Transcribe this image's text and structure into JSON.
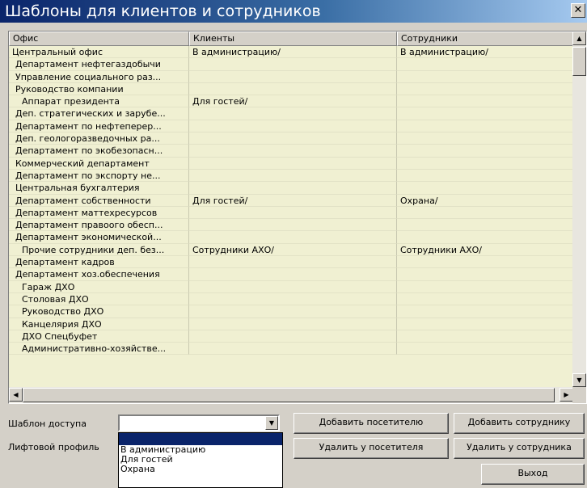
{
  "window": {
    "title": "Шаблоны для клиентов и сотрудников",
    "close_label": "✕"
  },
  "table": {
    "columns": [
      "Офис",
      "Клиенты",
      "Сотрудники"
    ],
    "rows": [
      [
        "Центральный офис",
        "В администрацию/",
        "В администрацию/"
      ],
      [
        "Департамент нефтегаздобычи",
        "",
        ""
      ],
      [
        "Управление социального раз...",
        "",
        ""
      ],
      [
        "Руководство компании",
        "",
        ""
      ],
      [
        "Аппарат президента",
        "Для гостей/",
        ""
      ],
      [
        "Деп. стратегических и зарубе...",
        "",
        ""
      ],
      [
        "Департамент по нефтеперер...",
        "",
        ""
      ],
      [
        "Деп. геологоразведочных ра...",
        "",
        ""
      ],
      [
        "Департамент по экобезопасн...",
        "",
        ""
      ],
      [
        "Коммерческий департамент",
        "",
        ""
      ],
      [
        "Департамент по экспорту не...",
        "",
        ""
      ],
      [
        "Центральная бухгалтерия",
        "",
        ""
      ],
      [
        "Департамент собственности",
        "Для гостей/",
        "Охрана/"
      ],
      [
        "Департамент маттехресурсов",
        "",
        ""
      ],
      [
        "Департамент правоого обесп...",
        "",
        ""
      ],
      [
        "Департамент экономической...",
        "",
        ""
      ],
      [
        "Прочие сотрудники деп. без...",
        "Сотрудники АХО/",
        "Сотрудники АХО/"
      ],
      [
        "Департамент кадров",
        "",
        ""
      ],
      [
        "Департамент хоз.обеспечения",
        "",
        ""
      ],
      [
        "Гараж ДХО",
        "",
        ""
      ],
      [
        "Столовая ДХО",
        "",
        ""
      ],
      [
        "Руководство ДХО",
        "",
        ""
      ],
      [
        "Канцелярия ДХО",
        "",
        ""
      ],
      [
        "ДХО Спецбуфет",
        "",
        ""
      ],
      [
        "Административно-хозяйстве...",
        "",
        ""
      ]
    ]
  },
  "scroll": {
    "up": "▲",
    "down": "▼",
    "left": "◀",
    "right": "▶"
  },
  "form": {
    "access_template_label": "Шаблон доступа",
    "access_template_value": "",
    "combo_arrow": "▼",
    "lift_profile_label": "Лифтовой профиль",
    "dropdown_options": [
      "В администрацию",
      "Для гостей",
      "Охрана"
    ]
  },
  "buttons": {
    "add_visitor": "Добавить посетителю",
    "add_employee": "Добавить сотруднику",
    "remove_visitor": "Удалить у посетителя",
    "remove_employee": "Удалить у сотрудника",
    "exit": "Выход"
  }
}
